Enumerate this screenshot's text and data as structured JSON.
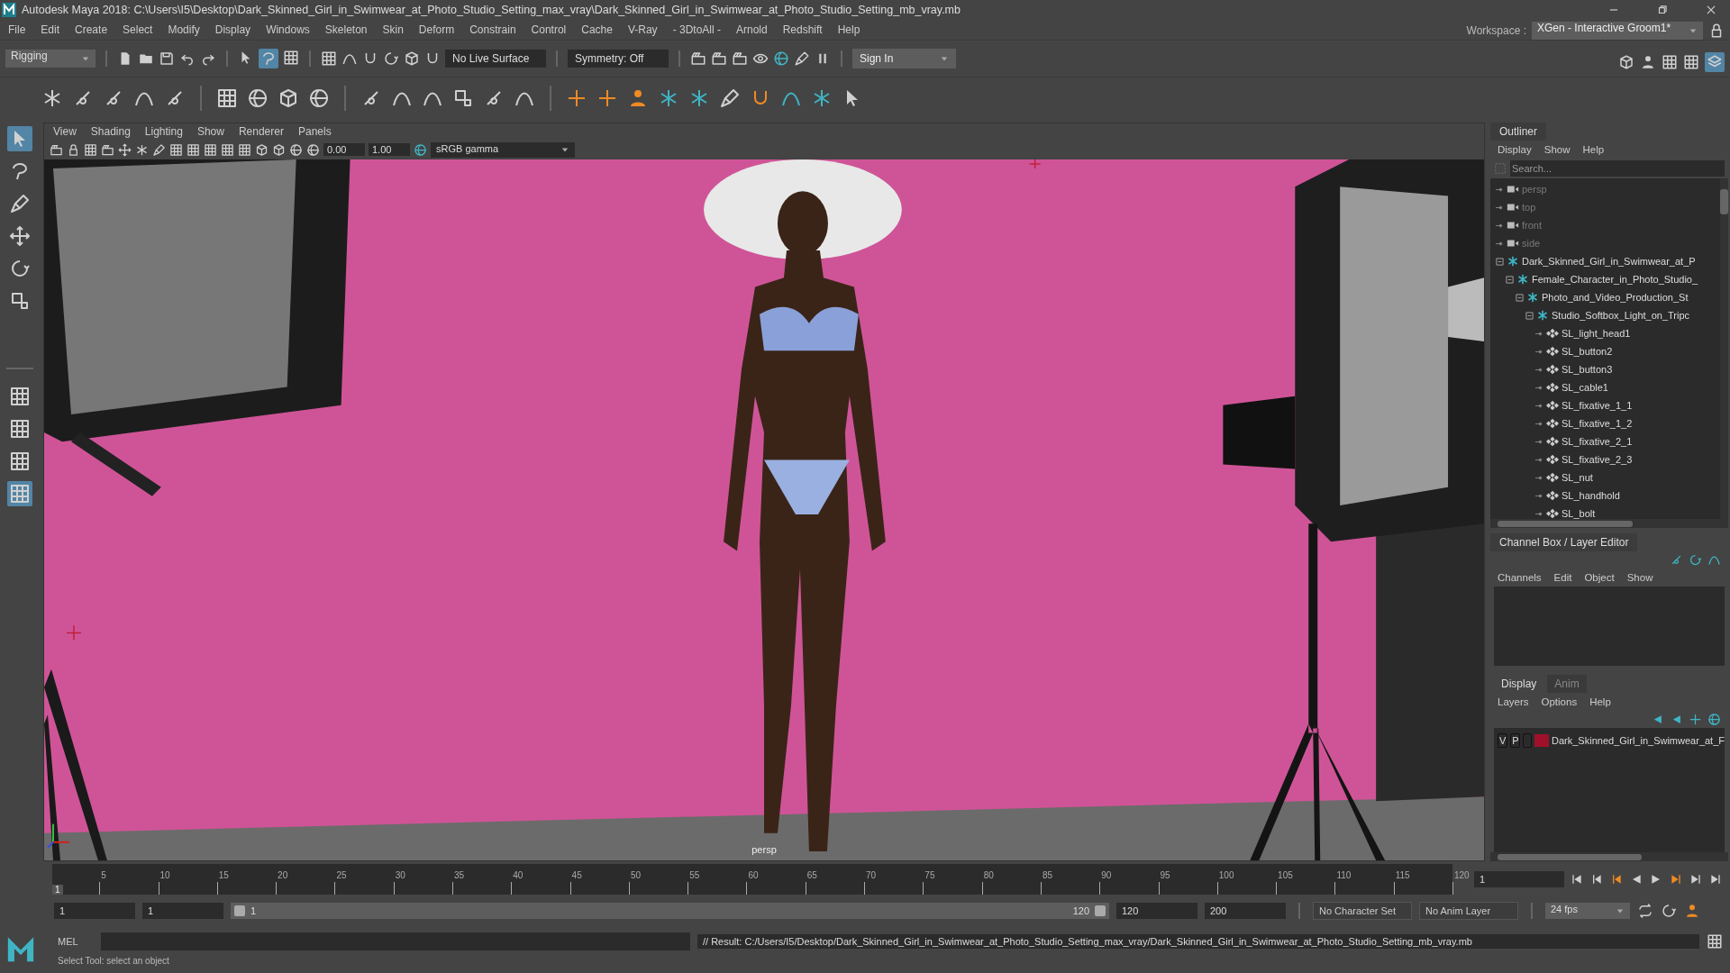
{
  "window": {
    "title": "Autodesk Maya 2018: C:\\Users\\I5\\Desktop\\Dark_Skinned_Girl_in_Swimwear_at_Photo_Studio_Setting_max_vray\\Dark_Skinned_Girl_in_Swimwear_at_Photo_Studio_Setting_mb_vray.mb"
  },
  "menu_bar": [
    "File",
    "Edit",
    "Create",
    "Select",
    "Modify",
    "Display",
    "Windows",
    "Skeleton",
    "Skin",
    "Deform",
    "Constrain",
    "Control",
    "Cache",
    "V-Ray",
    "- 3DtoAll -",
    "Arnold",
    "Redshift",
    "Help"
  ],
  "status_line": {
    "menu_set": "Rigging",
    "live_surface": "No Live Surface",
    "symmetry": "Symmetry: Off",
    "sign_in": "Sign In",
    "workspace_label": "Workspace :",
    "workspace": "XGen - Interactive Groom1*"
  },
  "viewport": {
    "menu": [
      "View",
      "Shading",
      "Lighting",
      "Show",
      "Renderer",
      "Panels"
    ],
    "exposure": "0.00",
    "gamma": "1.00",
    "color_space": "sRGB gamma",
    "camera": "persp"
  },
  "outliner": {
    "title": "Outliner",
    "menu": [
      "Display",
      "Show",
      "Help"
    ],
    "search": {
      "placeholder": "Search..."
    },
    "items": [
      {
        "kind": "camera",
        "name": "persp"
      },
      {
        "kind": "camera",
        "name": "top"
      },
      {
        "kind": "camera",
        "name": "front"
      },
      {
        "kind": "camera",
        "name": "side"
      },
      {
        "kind": "group",
        "name": "Dark_Skinned_Girl_in_Swimwear_at_P",
        "expanded": true,
        "children": [
          {
            "kind": "group",
            "name": "Female_Character_in_Photo_Studio_",
            "expanded": true,
            "children": [
              {
                "kind": "group",
                "name": "Photo_and_Video_Production_St",
                "expanded": true,
                "children": [
                  {
                    "kind": "group",
                    "name": "Studio_Softbox_Light_on_Tripc",
                    "expanded": true,
                    "children": [
                      {
                        "kind": "mesh",
                        "name": "SL_light_head1"
                      },
                      {
                        "kind": "mesh",
                        "name": "SL_button2"
                      },
                      {
                        "kind": "mesh",
                        "name": "SL_button3"
                      },
                      {
                        "kind": "mesh",
                        "name": "SL_cable1"
                      },
                      {
                        "kind": "mesh",
                        "name": "SL_fixative_1_1"
                      },
                      {
                        "kind": "mesh",
                        "name": "SL_fixative_1_2"
                      },
                      {
                        "kind": "mesh",
                        "name": "SL_fixative_2_1"
                      },
                      {
                        "kind": "mesh",
                        "name": "SL_fixative_2_3"
                      },
                      {
                        "kind": "mesh",
                        "name": "SL_nut"
                      },
                      {
                        "kind": "mesh",
                        "name": "SL_handhold"
                      },
                      {
                        "kind": "mesh",
                        "name": "SL_bolt"
                      }
                    ]
                  }
                ]
              }
            ]
          }
        ]
      }
    ]
  },
  "channel_box": {
    "title": "Channel Box / Layer Editor",
    "menu": [
      "Channels",
      "Edit",
      "Object",
      "Show"
    ]
  },
  "layer_editor": {
    "tabs": [
      {
        "label": "Display",
        "selected": true
      },
      {
        "label": "Anim",
        "selected": false
      }
    ],
    "menu": [
      "Layers",
      "Options",
      "Help"
    ],
    "layers": [
      {
        "visible": "V",
        "playback": "P",
        "color": "#a0102a",
        "name": "Dark_Skinned_Girl_in_Swimwear_at_F"
      }
    ]
  },
  "timeline": {
    "current": "1",
    "level": 0,
    "ticks": [
      "5",
      "10",
      "15",
      "20",
      "25",
      "30",
      "35",
      "40",
      "45",
      "50",
      "55",
      "60",
      "65",
      "70",
      "75",
      "80",
      "85",
      "90",
      "95",
      "100",
      "105",
      "110",
      "115",
      "120"
    ],
    "current_field": "1"
  },
  "range": {
    "level": 1,
    "start": "1",
    "playback_start": "1",
    "slider_start": "1",
    "slider_end": "120",
    "playback_end": "120",
    "end": "200",
    "character_set": "No Character Set",
    "anim_layer": "No Anim Layer",
    "fps": "24 fps"
  },
  "command_line": {
    "language": "MEL",
    "result": "// Result: C:/Users/I5/Desktop/Dark_Skinned_Girl_in_Swimwear_at_Photo_Studio_Setting_max_vray/Dark_Skinned_Girl_in_Swimwear_at_Photo_Studio_Setting_mb_vray.mb"
  },
  "help_line": "Select Tool: select an object"
}
